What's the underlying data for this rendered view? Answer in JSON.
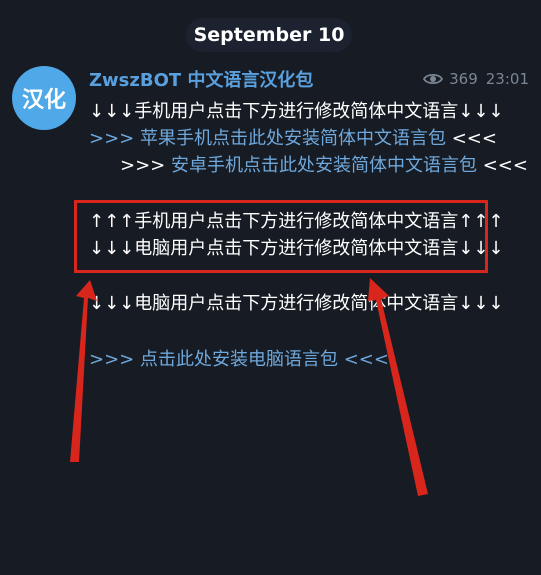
{
  "date_label": "September 10",
  "channel": {
    "avatar_text": "汉化",
    "name": "ZwszBOT 中文语言汉化包",
    "views": "369",
    "time": "23:01"
  },
  "message": {
    "line1": "↓↓↓手机用户点击下方进行修改简体中文语言↓↓↓",
    "ios_prefix": ">>> ",
    "ios_link": "苹果手机点击此处安装简体中文语言包",
    "ios_suffix": " <<<",
    "android_prefix": ">>> ",
    "android_link": "安卓手机点击此处安装简体中文语言包",
    "android_suffix": " <<<",
    "line_up": "↑↑↑手机用户点击下方进行修改简体中文语言↑↑↑",
    "line_pc1": "↓↓↓电脑用户点击下方进行修改简体中文语言↓↓↓",
    "line_pc2": "↓↓↓电脑用户点击下方进行修改简体中文语言↓↓↓",
    "pc_prefix": ">>> ",
    "pc_link": "点击此处安装电脑语言包",
    "pc_suffix": " <<<"
  },
  "colors": {
    "background": "#171c24",
    "link": "#6fa8dc",
    "channel_name": "#5aa0de",
    "avatar": "#4fa8e8",
    "annotation_red": "#d9261c"
  },
  "icons": {
    "views": "eye-icon"
  }
}
